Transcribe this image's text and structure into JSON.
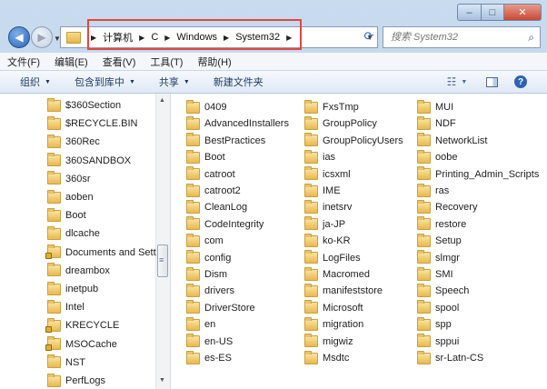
{
  "window": {
    "title_buttons": {
      "minimize": "–",
      "maximize": "□",
      "close": "✕"
    }
  },
  "nav": {
    "back_icon": "back-arrow-icon",
    "forward_icon": "forward-arrow-icon",
    "breadcrumb": [
      "计算机",
      "C",
      "Windows",
      "System32"
    ],
    "search_placeholder": "搜索 System32"
  },
  "menu": [
    "文件(F)",
    "编辑(E)",
    "查看(V)",
    "工具(T)",
    "帮助(H)"
  ],
  "commands": {
    "organize": "组织",
    "include_library": "包含到库中",
    "share": "共享",
    "new_folder": "新建文件夹"
  },
  "left_pane": {
    "items": [
      {
        "name": "$360Section",
        "locked": false
      },
      {
        "name": "$RECYCLE.BIN",
        "locked": false
      },
      {
        "name": "360Rec",
        "locked": false
      },
      {
        "name": "360SANDBOX",
        "locked": false
      },
      {
        "name": "360sr",
        "locked": false
      },
      {
        "name": "aoben",
        "locked": false
      },
      {
        "name": "Boot",
        "locked": false
      },
      {
        "name": "dlcache",
        "locked": false
      },
      {
        "name": "Documents and Sett",
        "locked": true
      },
      {
        "name": "dreambox",
        "locked": false
      },
      {
        "name": "inetpub",
        "locked": false
      },
      {
        "name": "Intel",
        "locked": false
      },
      {
        "name": "KRECYCLE",
        "locked": true
      },
      {
        "name": "MSOCache",
        "locked": true
      },
      {
        "name": "NST",
        "locked": false
      },
      {
        "name": "PerfLogs",
        "locked": false
      }
    ]
  },
  "folders": {
    "col1": [
      "0409",
      "AdvancedInstallers",
      "BestPractices",
      "Boot",
      "catroot",
      "catroot2",
      "CleanLog",
      "CodeIntegrity",
      "com",
      "config",
      "Dism",
      "drivers",
      "DriverStore",
      "en",
      "en-US",
      "es-ES"
    ],
    "col2": [
      "FxsTmp",
      "GroupPolicy",
      "GroupPolicyUsers",
      "ias",
      "icsxml",
      "IME",
      "inetsrv",
      "ja-JP",
      "ko-KR",
      "LogFiles",
      "Macromed",
      "manifeststore",
      "Microsoft",
      "migration",
      "migwiz",
      "Msdtc"
    ],
    "col3": [
      "MUI",
      "NDF",
      "NetworkList",
      "oobe",
      "Printing_Admin_Scripts",
      "ras",
      "Recovery",
      "restore",
      "Setup",
      "slmgr",
      "SMI",
      "Speech",
      "spool",
      "spp",
      "sppui",
      "sr-Latn-CS"
    ]
  },
  "colors": {
    "accent": "#2c62b7",
    "highlight_box": "#e4463f"
  }
}
